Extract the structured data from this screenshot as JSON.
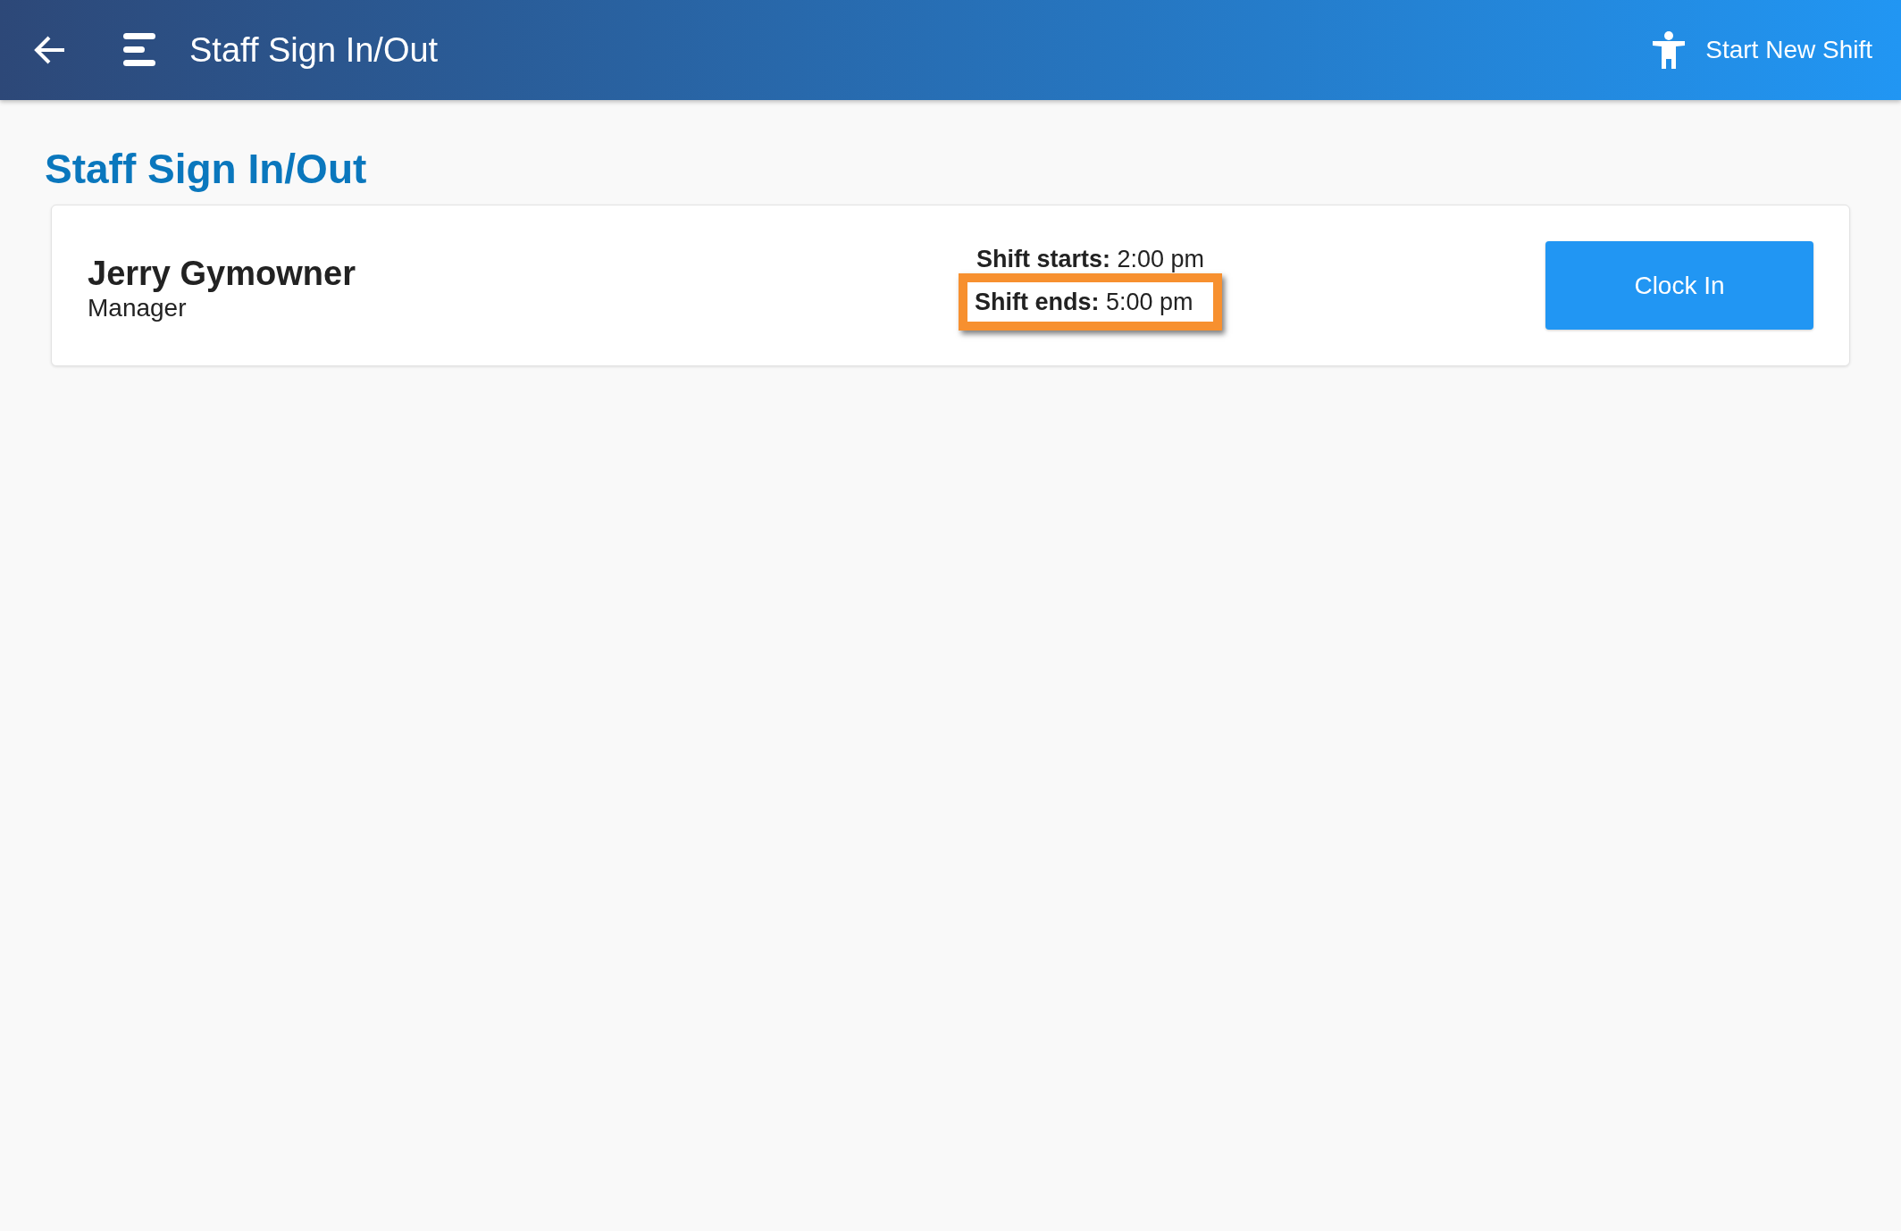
{
  "app_bar": {
    "title": "Staff Sign In/Out",
    "action": "Start New Shift"
  },
  "heading": "Staff Sign In/Out",
  "staff": [
    {
      "name": "Jerry Gymowner",
      "role": "Manager",
      "shifts": [
        {
          "label": "Shift starts:",
          "time": "2:00 pm",
          "highlighted": false
        },
        {
          "label": "Shift ends:",
          "time": "5:00 pm",
          "highlighted": true
        }
      ],
      "button": "Clock In"
    }
  ]
}
